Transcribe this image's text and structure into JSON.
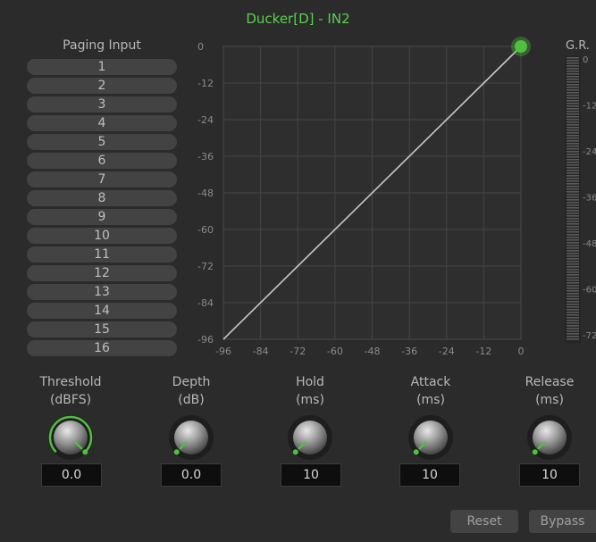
{
  "title": "Ducker[D] - IN2",
  "paging": {
    "header": "Paging Input",
    "inputs": [
      "1",
      "2",
      "3",
      "4",
      "5",
      "6",
      "7",
      "8",
      "9",
      "10",
      "11",
      "12",
      "13",
      "14",
      "15",
      "16"
    ]
  },
  "graph": {
    "y_ticks": [
      "0",
      "-12",
      "-24",
      "-36",
      "-48",
      "-60",
      "-72",
      "-84",
      "-96"
    ],
    "x_ticks": [
      "-96",
      "-84",
      "-72",
      "-60",
      "-48",
      "-36",
      "-24",
      "-12",
      "0"
    ],
    "range": [
      -96,
      0
    ],
    "grid": true,
    "line_from": [
      -96,
      -96
    ],
    "line_to": [
      0,
      0
    ],
    "handle": [
      0,
      0
    ],
    "line_color": "#c8c8c8",
    "handle_color": "#4fc03f"
  },
  "gr_meter": {
    "label": "G.R.",
    "ticks": [
      "0",
      "-12",
      "-24",
      "-36",
      "-48",
      "-60",
      "-72"
    ]
  },
  "controls": [
    {
      "name": "threshold",
      "label_line1": "Threshold",
      "label_line2": "(dBFS)",
      "value": "0.0",
      "level": 1.0,
      "accent": "#4fc03f"
    },
    {
      "name": "depth",
      "label_line1": "Depth",
      "label_line2": "(dB)",
      "value": "0.0",
      "level": 0.0,
      "accent": "#4fc03f"
    },
    {
      "name": "hold",
      "label_line1": "Hold",
      "label_line2": "(ms)",
      "value": "10",
      "level": 0.0,
      "accent": "#4fc03f"
    },
    {
      "name": "attack",
      "label_line1": "Attack",
      "label_line2": "(ms)",
      "value": "10",
      "level": 0.0,
      "accent": "#4fc03f"
    },
    {
      "name": "release",
      "label_line1": "Release",
      "label_line2": "(ms)",
      "value": "10",
      "level": 0.0,
      "accent": "#4fc03f"
    }
  ],
  "buttons": {
    "reset": "Reset",
    "bypass": "Bypass"
  }
}
